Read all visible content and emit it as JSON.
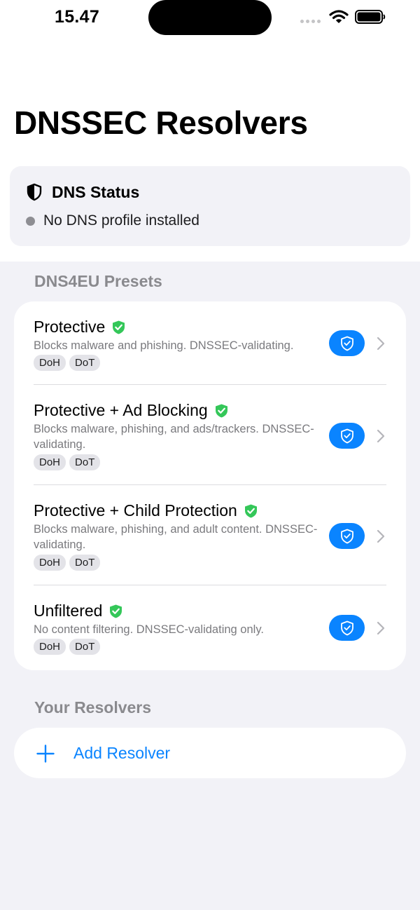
{
  "status_bar": {
    "time": "15.47"
  },
  "page": {
    "title": "DNSSEC Resolvers"
  },
  "dns_status": {
    "title": "DNS Status",
    "message": "No DNS profile installed"
  },
  "presets_section": {
    "header": "DNS4EU Presets",
    "items": [
      {
        "title": "Protective",
        "description": "Blocks malware and phishing. DNSSEC-validating.",
        "tags": [
          "DoH",
          "DoT"
        ]
      },
      {
        "title": "Protective + Ad Blocking",
        "description": "Blocks malware, phishing, and ads/trackers. DNSSEC-validating.",
        "tags": [
          "DoH",
          "DoT"
        ]
      },
      {
        "title": "Protective + Child Protection",
        "description": "Blocks malware, phishing, and adult content. DNSSEC-validating.",
        "tags": [
          "DoH",
          "DoT"
        ]
      },
      {
        "title": "Unfiltered",
        "description": "No content filtering. DNSSEC-validating only.",
        "tags": [
          "DoH",
          "DoT"
        ]
      }
    ]
  },
  "your_resolvers": {
    "header": "Your Resolvers",
    "add_label": "Add Resolver"
  },
  "colors": {
    "accent": "#0A84FF",
    "verified": "#34C759",
    "background": "#F2F2F7",
    "status_dot": "#8E8E93"
  }
}
